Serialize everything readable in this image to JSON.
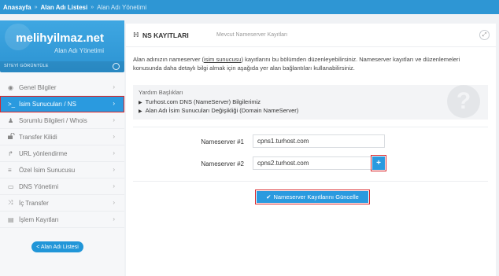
{
  "breadcrumb": {
    "items": [
      "Anasayfa",
      "Alan Adı Listesi",
      "Alan Adı Yönetimi"
    ]
  },
  "brand": {
    "domain": "melihyilmaz.net",
    "subtitle": "Alan Adı Yönetimi",
    "strip_label": "SİTEYİ GÖRÜNTÜLE"
  },
  "sidebar": {
    "items": [
      {
        "label": "Genel Bilgiler",
        "icon": "globe-icon",
        "glyph": "◉"
      },
      {
        "label": "İsim Sunucuları / NS",
        "icon": "terminal-icon",
        "glyph": ">_"
      },
      {
        "label": "Sorumlu Bilgileri / Whois",
        "icon": "user-icon",
        "glyph": "♟"
      },
      {
        "label": "Transfer Kilidi",
        "icon": "unlock-icon",
        "glyph": "🔓"
      },
      {
        "label": "URL yönlendirme",
        "icon": "redirect-icon",
        "glyph": "↱"
      },
      {
        "label": "Özel İsim Sunucusu",
        "icon": "list-icon",
        "glyph": "≡"
      },
      {
        "label": "DNS Yönetimi",
        "icon": "monitor-icon",
        "glyph": "▭"
      },
      {
        "label": "İç Transfer",
        "icon": "shuffle-icon",
        "glyph": "⤨"
      },
      {
        "label": "İşlem Kayıtları",
        "icon": "table-icon",
        "glyph": "▤"
      }
    ],
    "active_index": 1,
    "list_button": "< Alan Adı Listesi"
  },
  "panel": {
    "icon": "sitemap-icon",
    "title": "NS KAYITLARI",
    "subtitle": "Mevcut Nameserver Kayıtları",
    "desc_part1": "Alan adınızın nameserver (",
    "desc_underlined": "isim sunucusu",
    "desc_part2": ") kayıtlarını bu bölümden düzenleyebilirsiniz. Nameserver kayıtları ve düzenlemeleri",
    "desc_line2": "konusunda daha detaylı bilgi almak için aşağıda yer alan bağlantıları kullanabilirsiniz.",
    "help_title": "Yardım Başlıkları",
    "help_links": [
      "Turhost.com DNS (NameServer) Bilgilerimiz",
      "Alan Adı İsim Sunucuları Değişikliği (Domain NameServer)"
    ],
    "ns": [
      {
        "label": "Nameserver #1",
        "value": "cpns1.turhost.com"
      },
      {
        "label": "Nameserver #2",
        "value": "cpns2.turhost.com"
      }
    ],
    "add_label": "+",
    "update_label": "Nameserver Kayıtlarını Güncelle"
  }
}
